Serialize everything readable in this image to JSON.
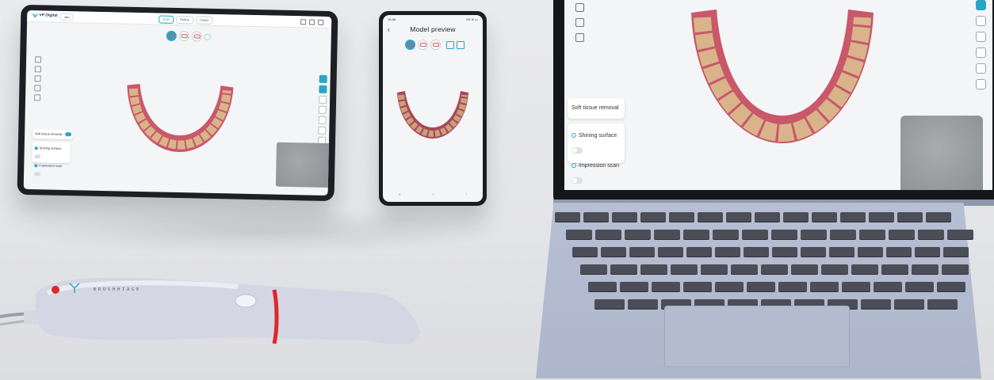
{
  "tablet": {
    "app_name": "VP Digital",
    "tab_chip": "abc",
    "tabs": [
      "Scan",
      "Refine",
      "Cases"
    ],
    "soft_tissue_label": "Soft tissue removal",
    "shining_label": "Shining surface",
    "impression_label": "Impression scan"
  },
  "phone": {
    "status_time": "16:38",
    "status_right": "5G ≋ ▭",
    "back": "‹",
    "title": "Model preview",
    "nav": [
      "≡",
      "□",
      "‹"
    ]
  },
  "laptop": {
    "soft_tissue_label": "Soft tissue removal",
    "shining_label": "Shining surface",
    "impression_label": "Impression scan"
  },
  "scanner": {
    "brand_text": "B R U S H   H I A G E"
  },
  "colors": {
    "accent": "#27a5c7",
    "gum": "#c9586a",
    "tooth": "#d9b48a",
    "scanner_ring": "#e0262c",
    "laptop_body": "#b3bbd0"
  },
  "icons": [
    "app-logo-icon",
    "window-control-icon",
    "upper-jaw-icon",
    "lower-jaw-icon",
    "bite-icon",
    "tool-icon",
    "preview-icon",
    "scan-mode-icon"
  ]
}
